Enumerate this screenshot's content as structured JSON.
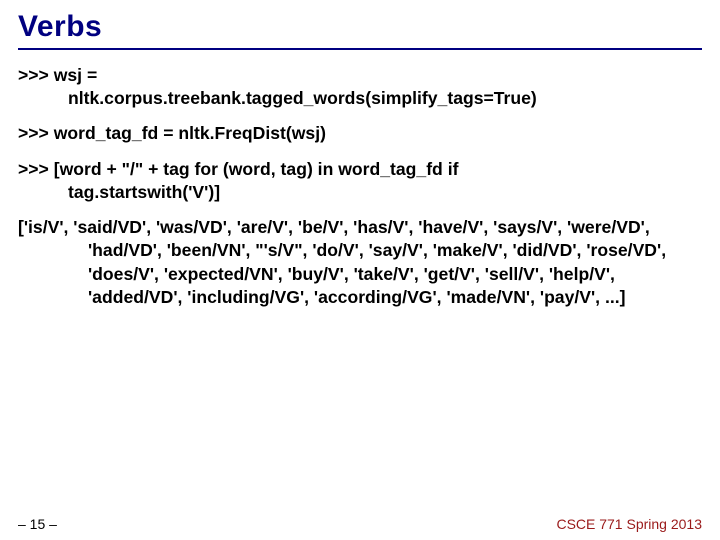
{
  "title": "Verbs",
  "code": {
    "line1a": ">>> wsj =",
    "line1b": "nltk.corpus.treebank.tagged_words(simplify_tags=True)",
    "line2": ">>> word_tag_fd = nltk.FreqDist(wsj)",
    "line3a": ">>> [word + \"/\" + tag for (word, tag) in word_tag_fd if",
    "line3b": "tag.startswith('V')]",
    "output": "['is/V', 'said/VD', 'was/VD', 'are/V', 'be/V', 'has/V', 'have/V', 'says/V', 'were/VD', 'had/VD', 'been/VN', \"'s/V\", 'do/V', 'say/V', 'make/V', 'did/VD', 'rose/VD', 'does/V', 'expected/VN', 'buy/V', 'take/V', 'get/V', 'sell/V', 'help/V', 'added/VD', 'including/VG', 'according/VG', 'made/VN', 'pay/V', ...]"
  },
  "footer": {
    "page": "– 15 –",
    "course": "CSCE 771 Spring 2013"
  }
}
